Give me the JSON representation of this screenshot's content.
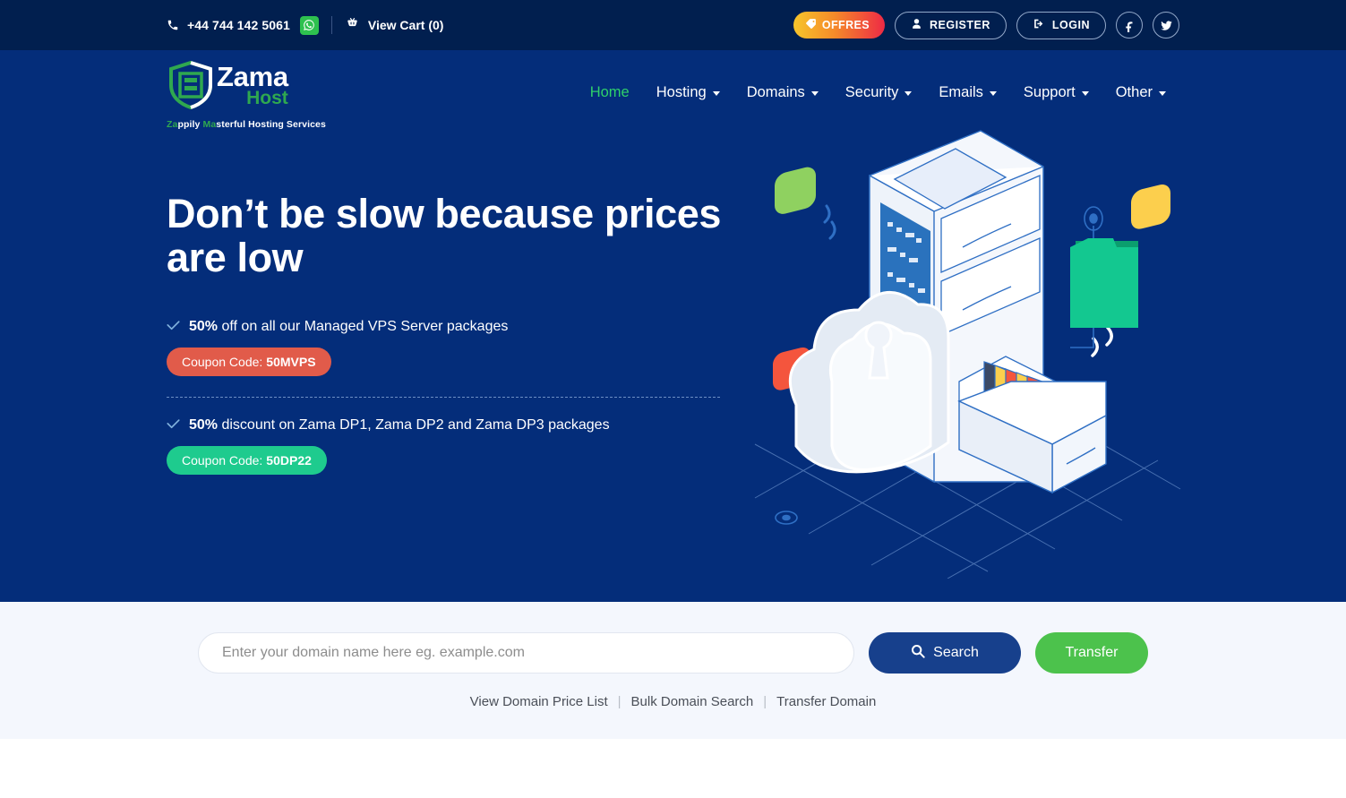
{
  "topbar": {
    "phone": "+44 744 142 5061",
    "phone_icon": "phone-icon",
    "whatsapp_icon": "whatsapp-icon",
    "cart_icon": "shopping-basket-icon",
    "cart_label": "View Cart (0)",
    "offres_label": "OFFRES",
    "offres_icon": "tag-icon",
    "register_label": "REGISTER",
    "register_icon": "user-icon",
    "login_label": "LOGIN",
    "login_icon": "sign-in-icon",
    "facebook_icon": "facebook-icon",
    "twitter_icon": "twitter-icon",
    "colors": {
      "background": "#011f4f",
      "offres_gradient_start": "#f7c52b",
      "offres_gradient_end": "#ee2a45",
      "whatsapp_green": "#2ec14f"
    }
  },
  "logo": {
    "name_main": "Zama",
    "name_sub": "Host",
    "tagline_parts": [
      {
        "text": "Za",
        "color": "green"
      },
      {
        "text": "ppily ",
        "color": "white"
      },
      {
        "text": "Ma",
        "color": "green"
      },
      {
        "text": "sterful Hosting Services",
        "color": "white"
      }
    ],
    "tagline_full": "Zappily Masterful Hosting Services",
    "shield_icon": "shield-server-icon",
    "green": "#2fa84f"
  },
  "nav": {
    "items": [
      {
        "label": "Home",
        "active": true,
        "has_dropdown": false
      },
      {
        "label": "Hosting",
        "active": false,
        "has_dropdown": true
      },
      {
        "label": "Domains",
        "active": false,
        "has_dropdown": true
      },
      {
        "label": "Security",
        "active": false,
        "has_dropdown": true
      },
      {
        "label": "Emails",
        "active": false,
        "has_dropdown": true
      },
      {
        "label": "Support",
        "active": false,
        "has_dropdown": true
      },
      {
        "label": "Other",
        "active": false,
        "has_dropdown": true
      }
    ],
    "active_color": "#2fd16a"
  },
  "hero": {
    "title": "Don’t be slow because prices are low",
    "background": "#042d7a",
    "offers": [
      {
        "highlight": "50%",
        "text": " off on all our Managed VPS Server packages",
        "coupon_label": "Coupon Code:",
        "coupon_code": "50MVPS",
        "coupon_color": "#e15b4a"
      },
      {
        "highlight": "50%",
        "text": " discount on Zama DP1, Zama DP2 and Zama DP3 packages",
        "coupon_label": "Coupon Code:",
        "coupon_code": "50DP22",
        "coupon_color": "#1ecb8e"
      }
    ],
    "check_icon": "check-icon",
    "illustration": "isometric-server-filing-cabinet-cloud-lock-illustration"
  },
  "search": {
    "placeholder": "Enter your domain name here eg. example.com",
    "value": "",
    "search_label": "Search",
    "search_icon": "search-icon",
    "transfer_label": "Transfer",
    "background": "#f4f7fd",
    "search_button_color": "#17408c",
    "transfer_button_color": "#4cc24c",
    "links": [
      {
        "label": "View Domain Price List"
      },
      {
        "label": "Bulk Domain Search"
      },
      {
        "label": "Transfer Domain"
      }
    ],
    "separator": "|"
  }
}
